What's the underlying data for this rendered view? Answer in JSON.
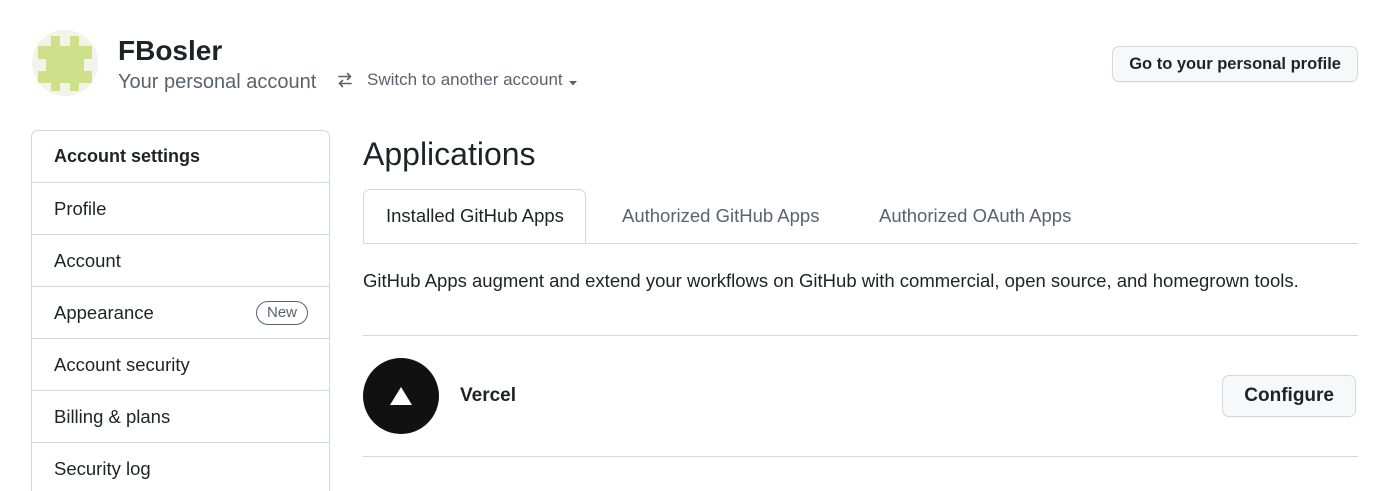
{
  "header": {
    "user_name": "FBosler",
    "account_type": "Your personal account",
    "switch_account_label": "Switch to another account",
    "profile_button_label": "Go to your personal profile",
    "avatar_color": "#cfe08a"
  },
  "sidebar": {
    "heading": "Account settings",
    "items": [
      {
        "label": "Profile"
      },
      {
        "label": "Account"
      },
      {
        "label": "Appearance",
        "badge": "New"
      },
      {
        "label": "Account security"
      },
      {
        "label": "Billing & plans"
      },
      {
        "label": "Security log"
      }
    ]
  },
  "main": {
    "title": "Applications",
    "tabs": [
      {
        "label": "Installed GitHub Apps",
        "active": true
      },
      {
        "label": "Authorized GitHub Apps",
        "active": false
      },
      {
        "label": "Authorized OAuth Apps",
        "active": false
      }
    ],
    "description": "GitHub Apps augment and extend your workflows on GitHub with commercial, open source, and homegrown tools.",
    "apps": [
      {
        "name": "Vercel",
        "icon": "vercel-triangle-icon",
        "action_label": "Configure"
      }
    ]
  },
  "colors": {
    "text_primary": "#1f2328",
    "text_muted": "#59636e",
    "border": "#d1d9e0",
    "button_bg": "#f6f8fa",
    "vercel_bg": "#111111"
  }
}
